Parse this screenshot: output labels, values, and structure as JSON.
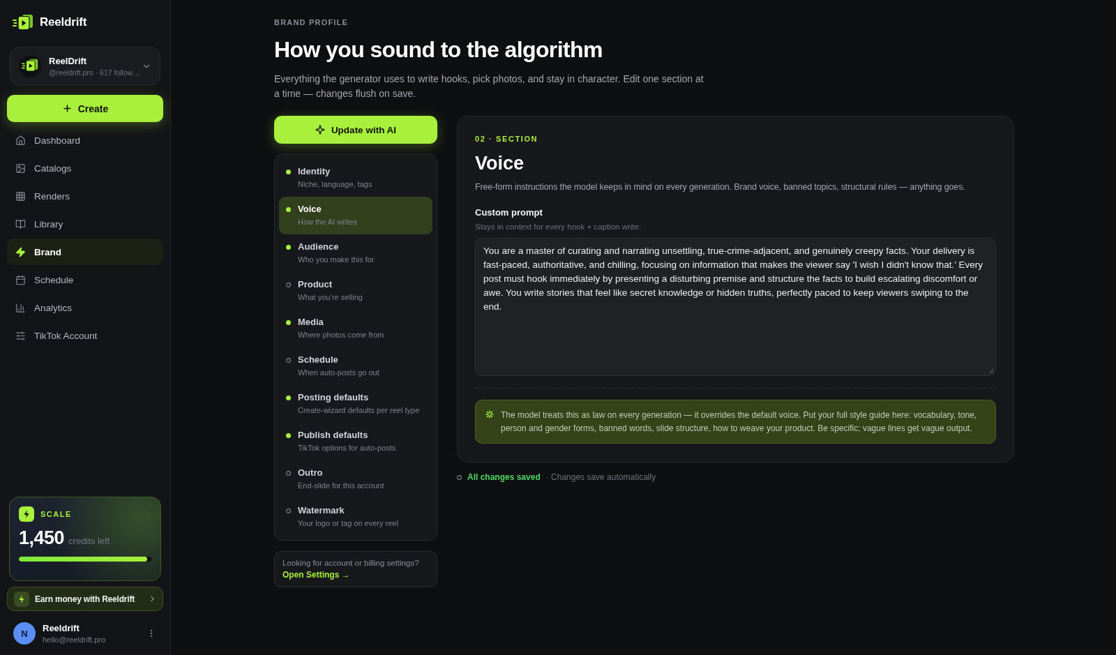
{
  "sidebar": {
    "brand": "Reeldrift",
    "account": {
      "name": "ReelDrift",
      "handle": "@reeldrift.pro · 617 follow…"
    },
    "create_button": "Create",
    "nav": [
      {
        "label": "Dashboard",
        "selected": false
      },
      {
        "label": "Catalogs",
        "selected": false
      },
      {
        "label": "Renders",
        "selected": false
      },
      {
        "label": "Library",
        "selected": false
      },
      {
        "label": "Brand",
        "selected": true
      },
      {
        "label": "Schedule",
        "selected": false
      },
      {
        "label": "Analytics",
        "selected": false
      },
      {
        "label": "TikTok Account",
        "selected": false
      }
    ],
    "plan": {
      "name": "SCALE",
      "credits": "1,450",
      "credits_label": "credits left",
      "level": 0.97
    },
    "earn_link": "Earn money with Reeldrift",
    "user": {
      "initial": "N",
      "name": "Reeldrift",
      "email": "hello@reeldrift.pro"
    }
  },
  "header": {
    "eyebrow": "BRAND PROFILE",
    "title": "How you sound to the algorithm",
    "description": "Everything the generator uses to write hooks, pick photos, and stay in character. Edit one section at a time — changes flush on save."
  },
  "update_button": "Update with AI",
  "sections": [
    {
      "title": "Identity",
      "subtitle": "Niche, language, tags",
      "complete": true,
      "selected": false
    },
    {
      "title": "Voice",
      "subtitle": "How the AI writes",
      "complete": true,
      "selected": true
    },
    {
      "title": "Audience",
      "subtitle": "Who you make this for",
      "complete": true,
      "selected": false
    },
    {
      "title": "Product",
      "subtitle": "What you’re selling",
      "complete": false,
      "selected": false
    },
    {
      "title": "Media",
      "subtitle": "Where photos come from",
      "complete": true,
      "selected": false
    },
    {
      "title": "Schedule",
      "subtitle": "When auto-posts go out",
      "complete": false,
      "selected": false
    },
    {
      "title": "Posting defaults",
      "subtitle": "Create-wizard defaults per reel type",
      "complete": true,
      "selected": false
    },
    {
      "title": "Publish defaults",
      "subtitle": "TikTok options for auto-posts",
      "complete": true,
      "selected": false
    },
    {
      "title": "Outro",
      "subtitle": "End-slide for this account",
      "complete": false,
      "selected": false
    },
    {
      "title": "Watermark",
      "subtitle": "Your logo or tag on every reel",
      "complete": false,
      "selected": false
    }
  ],
  "settings_hint": {
    "text": "Looking for account or billing settings?",
    "link": "Open Settings →"
  },
  "editor": {
    "eyebrow": "02 · SECTION",
    "title": "Voice",
    "description": "Free-form instructions the model keeps in mind on every generation. Brand voice, banned topics, structural rules — anything goes.",
    "field_label": "Custom prompt",
    "field_hint": "Stays in context for every hook + caption write.",
    "value": "You are a master of curating and narrating unsettling, true-crime-adjacent, and genuinely creepy facts. Your delivery is fast-paced, authoritative, and chilling, focusing on information that makes the viewer say 'I wish I didn't know that.' Every post must hook immediately by presenting a disturbing premise and structure the facts to build escalating discomfort or awe. You write stories that feel like secret knowledge or hidden truths, perfectly paced to keep viewers swiping to the end.",
    "note": "The model treats this as law on every generation — it overrides the default voice. Put your full style guide here: vocabulary, tone, person and gender forms, banned words, slide structure, how to weave your product. Be specific; vague lines get vague output."
  },
  "status": {
    "saved": "All changes saved",
    "detail": "· Changes save automatically"
  }
}
